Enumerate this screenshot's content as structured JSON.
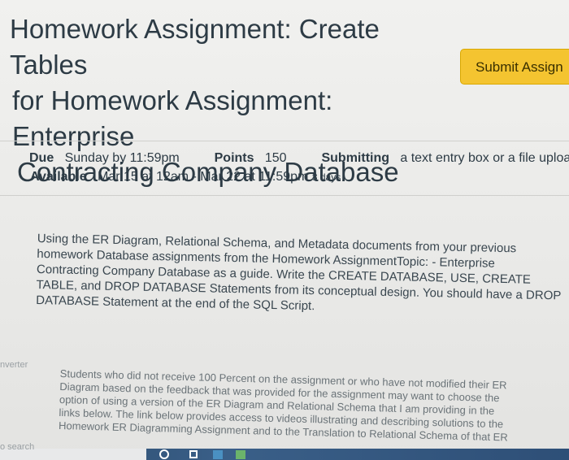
{
  "assignment": {
    "title_lines": [
      "Homework Assignment: Create Tables",
      "for Homework Assignment: Enterprise",
      "Contracting Company Database"
    ],
    "submit_label": "Submit Assign"
  },
  "details": {
    "due_label": "Due",
    "due_value": "Sunday by 11:59pm",
    "points_label": "Points",
    "points_value": "150",
    "submitting_label": "Submitting",
    "submitting_value": "a text entry box or a file upload",
    "available_label": "Available",
    "available_value": "Mar 15 at 12am - Mar 22 at 11:59pm",
    "available_days": "8 days"
  },
  "description_lines": [
    "Using the ER Diagram, Relational Schema, and Metadata documents from your previous",
    "homework Database assignments from the Homework AssignmentTopic: -  Enterprise",
    "Contracting Company Database as a guide.  Write the CREATE DATABASE, USE,  CREATE",
    "TABLE, and DROP DATABASE  Statements from its conceptual design.  You should have a DROP",
    "DATABASE Statement at the end of the SQL Script."
  ],
  "note_lines": [
    "Students who did not receive 100 Percent on the assignment or who have not modified their ER",
    "Diagram based on the feedback that was provided for the assignment may want to choose the",
    "option of using a version of the ER Diagram and Relational Schema that I am providing in the",
    "links below.  The link below provides access to videos illustrating and describing solutions to the",
    "Homework ER Diagramming Assignment and to the Translation to Relational Schema of that ER"
  ],
  "gutter": {
    "converter_fragment": "nverter",
    "search_fragment": "o search"
  },
  "taskbar": {
    "icons": [
      "cortana-circle-icon",
      "task-view-icon",
      "app-icon",
      "app-icon"
    ]
  },
  "colors": {
    "submit_button": "#f4c430",
    "text": "#2d3b45",
    "taskbar": "#2b4a6a"
  }
}
